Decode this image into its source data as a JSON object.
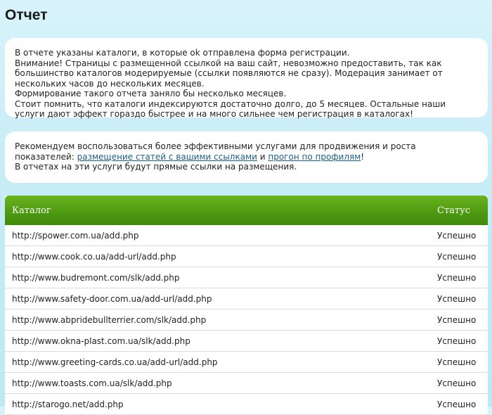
{
  "page": {
    "title": "Отчет"
  },
  "info_box": {
    "lines": [
      "В отчете указаны каталоги, в которые ok отправлена форма регистрации.",
      "Внимание! Страницы с размещенной ссылкой на ваш сайт, невозможно предоставить, так как большинство каталогов модерируемые (ссылки появляются не сразу). Модерация занимает от нескольких часов до нескольких месяцев.",
      "Формирование такого отчета заняло бы несколько месяцев.",
      "Стоит помнить, что каталоги индексируются достаточно долго, до 5 месяцев. Остальные наши услуги дают эффект гораздо быстрее и на много сильнее чем регистрация в каталогах!"
    ]
  },
  "promo_box": {
    "intro": "Рекомендуем воспользоваться более эффективными услугами для продвижения и роста показателей: ",
    "link1": "размещение статей с вашими ссылками",
    "conjunction": " и ",
    "link2": "прогон по профилям",
    "end": "!",
    "note": "В отчетах на эти услуги будут прямые ссылки на размещения."
  },
  "table": {
    "headers": {
      "catalog": "Каталог",
      "status": "Статус"
    },
    "rows": [
      {
        "url": "http://spower.com.ua/add.php",
        "status": "Успешно"
      },
      {
        "url": "http://www.cook.co.ua/add-url/add.php",
        "status": "Успешно"
      },
      {
        "url": "http://www.budremont.com/slk/add.php",
        "status": "Успешно"
      },
      {
        "url": "http://www.safety-door.com.ua/add-url/add.php",
        "status": "Успешно"
      },
      {
        "url": "http://www.abpridebullterrier.com/slk/add.php",
        "status": "Успешно"
      },
      {
        "url": "http://www.okna-plast.com.ua/slk/add.php",
        "status": "Успешно"
      },
      {
        "url": "http://www.greeting-cards.co.ua/add-url/add.php",
        "status": "Успешно"
      },
      {
        "url": "http://www.toasts.com.ua/slk/add.php",
        "status": "Успешно"
      },
      {
        "url": "http://starogo.net/add.php",
        "status": "Успешно"
      }
    ]
  }
}
